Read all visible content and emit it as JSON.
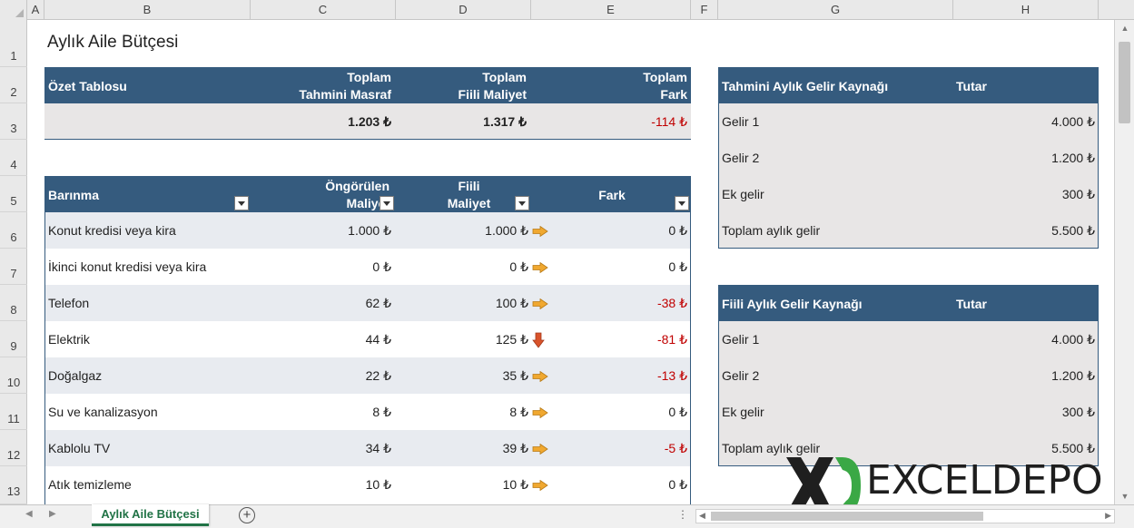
{
  "columns": [
    "A",
    "B",
    "C",
    "D",
    "E",
    "F",
    "G",
    "H"
  ],
  "rows": [
    "1",
    "2",
    "3",
    "4",
    "5",
    "6",
    "7",
    "8",
    "9",
    "10",
    "11",
    "12",
    "13"
  ],
  "title": "Aylık Aile Bütçesi",
  "summary": {
    "label": "Özet Tablosu",
    "headers": [
      {
        "line1": "Toplam",
        "line2": "Tahmini Masraf"
      },
      {
        "line1": "Toplam",
        "line2": "Fiili Maliyet"
      },
      {
        "line1": "Toplam",
        "line2": "Fark"
      }
    ],
    "values": [
      "1.203 ₺",
      "1.317 ₺",
      "-114 ₺"
    ]
  },
  "housing": {
    "header": "Barınma",
    "col_estimated": {
      "line1": "Öngörülen",
      "line2": "Maliyet"
    },
    "col_actual": {
      "line1": "Fiili",
      "line2": "Maliyet"
    },
    "col_diff": "Fark",
    "rows": [
      {
        "item": "Konut kredisi veya kira",
        "estimated": "1.000 ₺",
        "actual": "1.000 ₺",
        "icon": "right-arrow-icon",
        "diff": "0 ₺"
      },
      {
        "item": "İkinci konut kredisi veya kira",
        "estimated": "0 ₺",
        "actual": "0 ₺",
        "icon": "right-arrow-icon",
        "diff": "0 ₺"
      },
      {
        "item": "Telefon",
        "estimated": "62 ₺",
        "actual": "100 ₺",
        "icon": "right-arrow-icon",
        "diff": "-38 ₺"
      },
      {
        "item": "Elektrik",
        "estimated": "44 ₺",
        "actual": "125 ₺",
        "icon": "down-arrow-icon",
        "diff": "-81 ₺"
      },
      {
        "item": "Doğalgaz",
        "estimated": "22 ₺",
        "actual": "35 ₺",
        "icon": "right-arrow-icon",
        "diff": "-13 ₺"
      },
      {
        "item": "Su ve kanalizasyon",
        "estimated": "8 ₺",
        "actual": "8 ₺",
        "icon": "right-arrow-icon",
        "diff": "0 ₺"
      },
      {
        "item": "Kablolu TV",
        "estimated": "34 ₺",
        "actual": "39 ₺",
        "icon": "right-arrow-icon",
        "diff": "-5 ₺"
      },
      {
        "item": "Atık temizleme",
        "estimated": "10 ₺",
        "actual": "10 ₺",
        "icon": "right-arrow-icon",
        "diff": "0 ₺"
      }
    ]
  },
  "estimated_income": {
    "header": "Tahmini Aylık Gelir Kaynağı",
    "amount_header": "Tutar",
    "rows": [
      {
        "label": "Gelir 1",
        "value": "4.000 ₺"
      },
      {
        "label": "Gelir 2",
        "value": "1.200 ₺"
      },
      {
        "label": "Ek gelir",
        "value": "300 ₺"
      },
      {
        "label": "Toplam aylık gelir",
        "value": "5.500 ₺"
      }
    ]
  },
  "actual_income": {
    "header": "Fiili Aylık Gelir Kaynağı",
    "amount_header": "Tutar",
    "rows": [
      {
        "label": "Gelir 1",
        "value": "4.000 ₺"
      },
      {
        "label": "Gelir 2",
        "value": "1.200 ₺"
      },
      {
        "label": "Ek gelir",
        "value": "300 ₺"
      },
      {
        "label": "Toplam aylık gelir",
        "value": "5.500 ₺"
      }
    ]
  },
  "sheet_tab": "Aylık Aile Bütçesi",
  "logo_text": "EXCELDEPO",
  "colors": {
    "header_bg": "#355b7e",
    "band_bg": "#e8ebf0",
    "negative": "#c00000",
    "accent": "#217346",
    "arrow_right": "#f0a830",
    "arrow_down": "#d9532b"
  }
}
